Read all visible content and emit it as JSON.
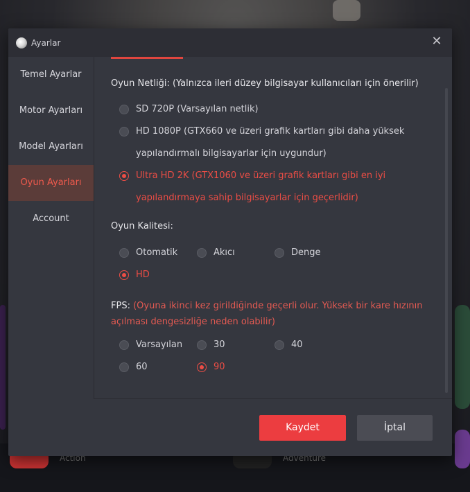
{
  "window": {
    "title": "Ayarlar"
  },
  "sidebar": {
    "items": [
      {
        "label": "Temel Ayarlar",
        "active": false
      },
      {
        "label": "Motor Ayarları",
        "active": false
      },
      {
        "label": "Model Ayarları",
        "active": false
      },
      {
        "label": "Oyun Ayarları",
        "active": true
      },
      {
        "label": "Account",
        "active": false
      }
    ]
  },
  "resolution": {
    "title": "Oyun Netliği: (Yalnızca ileri düzey bilgisayar kullanıcıları için önerilir)",
    "options": [
      {
        "label": "SD 720P (Varsayılan netlik)",
        "selected": false
      },
      {
        "label": "HD 1080P (GTX660 ve üzeri grafik kartları gibi daha yüksek yapılandırmalı bilgisayarlar için uygundur)",
        "selected": false
      },
      {
        "label": "Ultra HD 2K (GTX1060 ve üzeri grafik kartları gibi en iyi yapılandırmaya sahip bilgisayarlar için geçerlidir)",
        "selected": true
      }
    ]
  },
  "quality": {
    "title": "Oyun Kalitesi:",
    "options": [
      {
        "label": "Otomatik",
        "selected": false
      },
      {
        "label": "Akıcı",
        "selected": false
      },
      {
        "label": "Denge",
        "selected": false
      },
      {
        "label": "HD",
        "selected": true
      }
    ]
  },
  "fps": {
    "title": "FPS:",
    "note": "(Oyuna ikinci kez girildiğinde geçerli olur. Yüksek bir kare hızının açılması dengesizliğe neden olabilir)",
    "options": [
      {
        "label": "Varsayılan",
        "selected": false
      },
      {
        "label": "30",
        "selected": false
      },
      {
        "label": "40",
        "selected": false
      },
      {
        "label": "60",
        "selected": false
      },
      {
        "label": "90",
        "selected": true
      }
    ]
  },
  "buttons": {
    "save": "Kaydet",
    "cancel": "İptal"
  },
  "background": {
    "labels": [
      "Action",
      "Adventure"
    ]
  },
  "colors": {
    "accent": "#ec3d40",
    "selected_text": "#ec4d45",
    "modal_bg": "#35373f"
  }
}
